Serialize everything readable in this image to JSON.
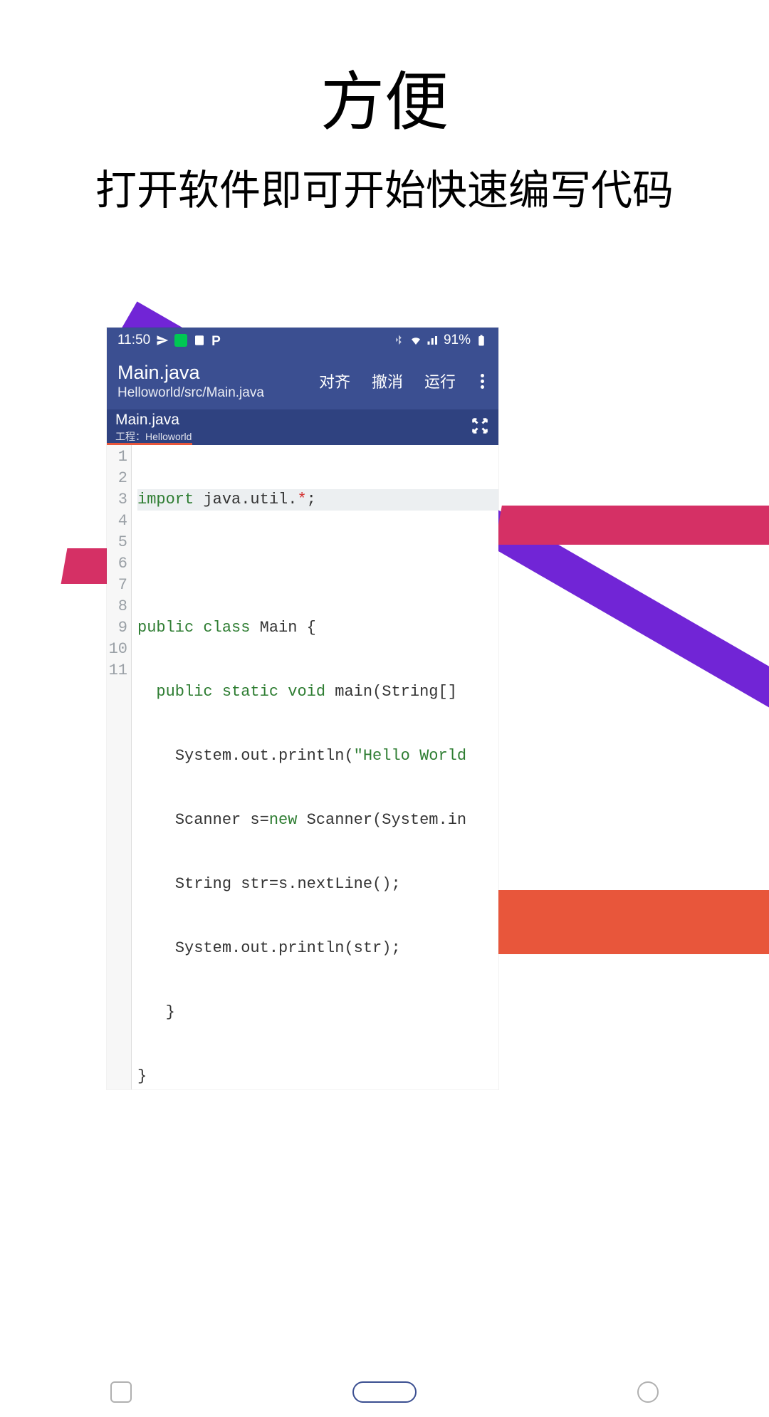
{
  "promo": {
    "title": "方便",
    "subtitle": "打开软件即可开始快速编写代码"
  },
  "status_bar": {
    "time": "11:50",
    "battery": "91%"
  },
  "toolbar": {
    "title": "Main.java",
    "path": "Helloworld/src/Main.java",
    "align_label": "对齐",
    "undo_label": "撤消",
    "run_label": "运行"
  },
  "tab": {
    "name": "Main.java",
    "project": "工程：Helloworld"
  },
  "code": {
    "lines": [
      "1",
      "2",
      "3",
      "4",
      "5",
      "6",
      "7",
      "8",
      "9",
      "10",
      "11"
    ],
    "l1": {
      "kw": "import",
      "rest": " java.util.",
      "op": "*",
      "semi": ";"
    },
    "l3": {
      "kw1": "public",
      "kw2": "class",
      "name": " Main {"
    },
    "l4": {
      "pad": "  ",
      "kw1": "public",
      "kw2": "static",
      "kw3": "void",
      "rest": " main(String[]"
    },
    "l5": {
      "pad": "    ",
      "txt1": "System.out.println(",
      "str": "\"Hello World"
    },
    "l6": {
      "pad": "    ",
      "txt1": "Scanner s=",
      "kw": "new",
      "txt2": " Scanner(System.in"
    },
    "l7": {
      "pad": "    ",
      "txt": "String str=s.nextLine();"
    },
    "l8": {
      "pad": "    ",
      "txt": "System.out.println(str);"
    },
    "l9": {
      "pad": "   ",
      "txt": "}"
    },
    "l10": {
      "txt": "}"
    }
  }
}
